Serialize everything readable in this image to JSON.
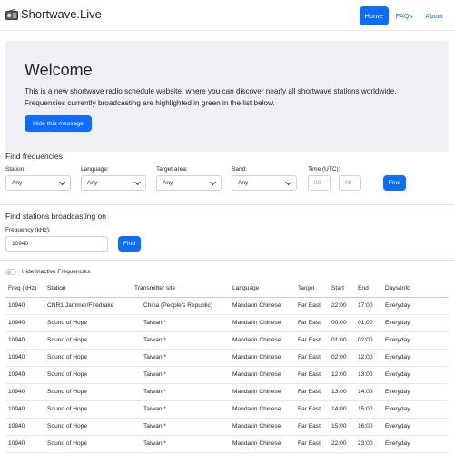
{
  "nav": {
    "brand": "Shortwave.Live",
    "links": [
      "Home",
      "FAQs",
      "About"
    ]
  },
  "welcome": {
    "title": "Welcome",
    "text": "This is a new shortwave radio schedule website, where you can discover nearly all shortwave stations worldwide. Frequencies currently broadcasting are highlighted in green in the list below.",
    "hide_button": "Hide this message"
  },
  "find_frequencies": {
    "title": "Find frequencies",
    "station_label": "Station:",
    "station_value": "Any",
    "language_label": "Language:",
    "language_value": "Any",
    "target_label": "Target area:",
    "target_value": "Any",
    "band_label": "Band:",
    "band_value": "Any",
    "time_label": "Time (UTC):",
    "time_from_placeholder": "00",
    "time_to_placeholder": "00",
    "find_button": "Find"
  },
  "find_stations": {
    "title": "Find stations broadcasting on",
    "frequency_label": "Frequency (kHz):",
    "frequency_value": "10940",
    "find_button": "Find"
  },
  "toggle": {
    "label": "Hide Inactive Frequencies"
  },
  "table": {
    "headers": [
      "Freq (kHz)",
      "Station",
      "Transmitter site",
      "Language",
      "Target",
      "Start",
      "End",
      "Days/Info"
    ],
    "rows": [
      [
        "10940",
        "CNR1 Jammer/Firedrake",
        "China (People's Republic)",
        "Mandarin Chinese",
        "Far East",
        "22:00",
        "17:00",
        "Everyday"
      ],
      [
        "10940",
        "Sound of Hope",
        "Taiwan *",
        "Mandarin Chinese",
        "Far East",
        "00:00",
        "01:00",
        "Everyday"
      ],
      [
        "10940",
        "Sound of Hope",
        "Taiwan *",
        "Mandarin Chinese",
        "Far East",
        "01:00",
        "02:00",
        "Everyday"
      ],
      [
        "10940",
        "Sound of Hope",
        "Taiwan *",
        "Mandarin Chinese",
        "Far East",
        "02:00",
        "12:00",
        "Everyday"
      ],
      [
        "10940",
        "Sound of Hope",
        "Taiwan *",
        "Mandarin Chinese",
        "Far East",
        "12:00",
        "13:00",
        "Everyday"
      ],
      [
        "10940",
        "Sound of Hope",
        "Taiwan *",
        "Mandarin Chinese",
        "Far East",
        "13:00",
        "14:00",
        "Everyday"
      ],
      [
        "10940",
        "Sound of Hope",
        "Taiwan *",
        "Mandarin Chinese",
        "Far East",
        "14:00",
        "15:00",
        "Everyday"
      ],
      [
        "10940",
        "Sound of Hope",
        "Taiwan *",
        "Mandarin Chinese",
        "Far East",
        "15:00",
        "16:00",
        "Everyday"
      ],
      [
        "10940",
        "Sound of Hope",
        "Taiwan *",
        "Mandarin Chinese",
        "Far East",
        "22:00",
        "23:00",
        "Everyday"
      ]
    ]
  },
  "colors": {
    "primary": "#0d6efd",
    "jumbotron_bg": "#eef0f3"
  },
  "icons": {
    "brand": "radio-icon"
  }
}
